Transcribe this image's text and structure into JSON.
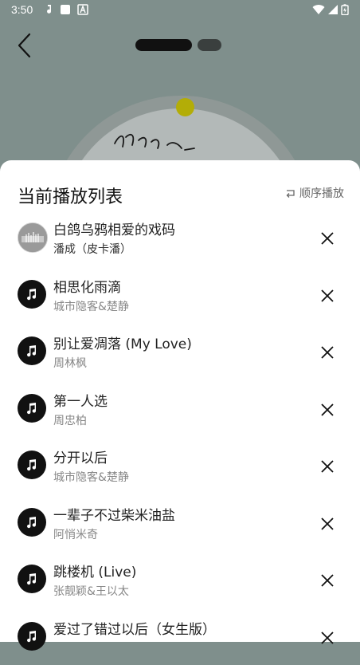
{
  "status": {
    "time": "3:50"
  },
  "player": {
    "colors": {
      "background": "#7f8f8c",
      "dot": "#b3ad07"
    }
  },
  "queue": {
    "title": "当前播放列表",
    "mode_label": "顺序播放",
    "items": [
      {
        "title": "白鸽乌鸦相爱的戏码",
        "artist": "潘成（皮卡潘）",
        "thumb": "album-photo"
      },
      {
        "title": "相思化雨滴",
        "artist": "城市隐客&楚静",
        "thumb": "music-note-icon"
      },
      {
        "title": "别让爱凋落 (My Love)",
        "artist": "周林枫",
        "thumb": "music-note-icon"
      },
      {
        "title": "第一人选",
        "artist": "周忠柏",
        "thumb": "music-note-icon"
      },
      {
        "title": "分开以后",
        "artist": "城市隐客&楚静",
        "thumb": "music-note-icon"
      },
      {
        "title": "一辈子不过柴米油盐",
        "artist": "阿悄米奇",
        "thumb": "music-note-icon"
      },
      {
        "title": "跳楼机 (Live)",
        "artist": "张靓颖&王以太",
        "thumb": "music-note-icon"
      },
      {
        "title": "爱过了错过以后（女生版）",
        "artist": "",
        "thumb": "music-note-icon"
      }
    ]
  }
}
